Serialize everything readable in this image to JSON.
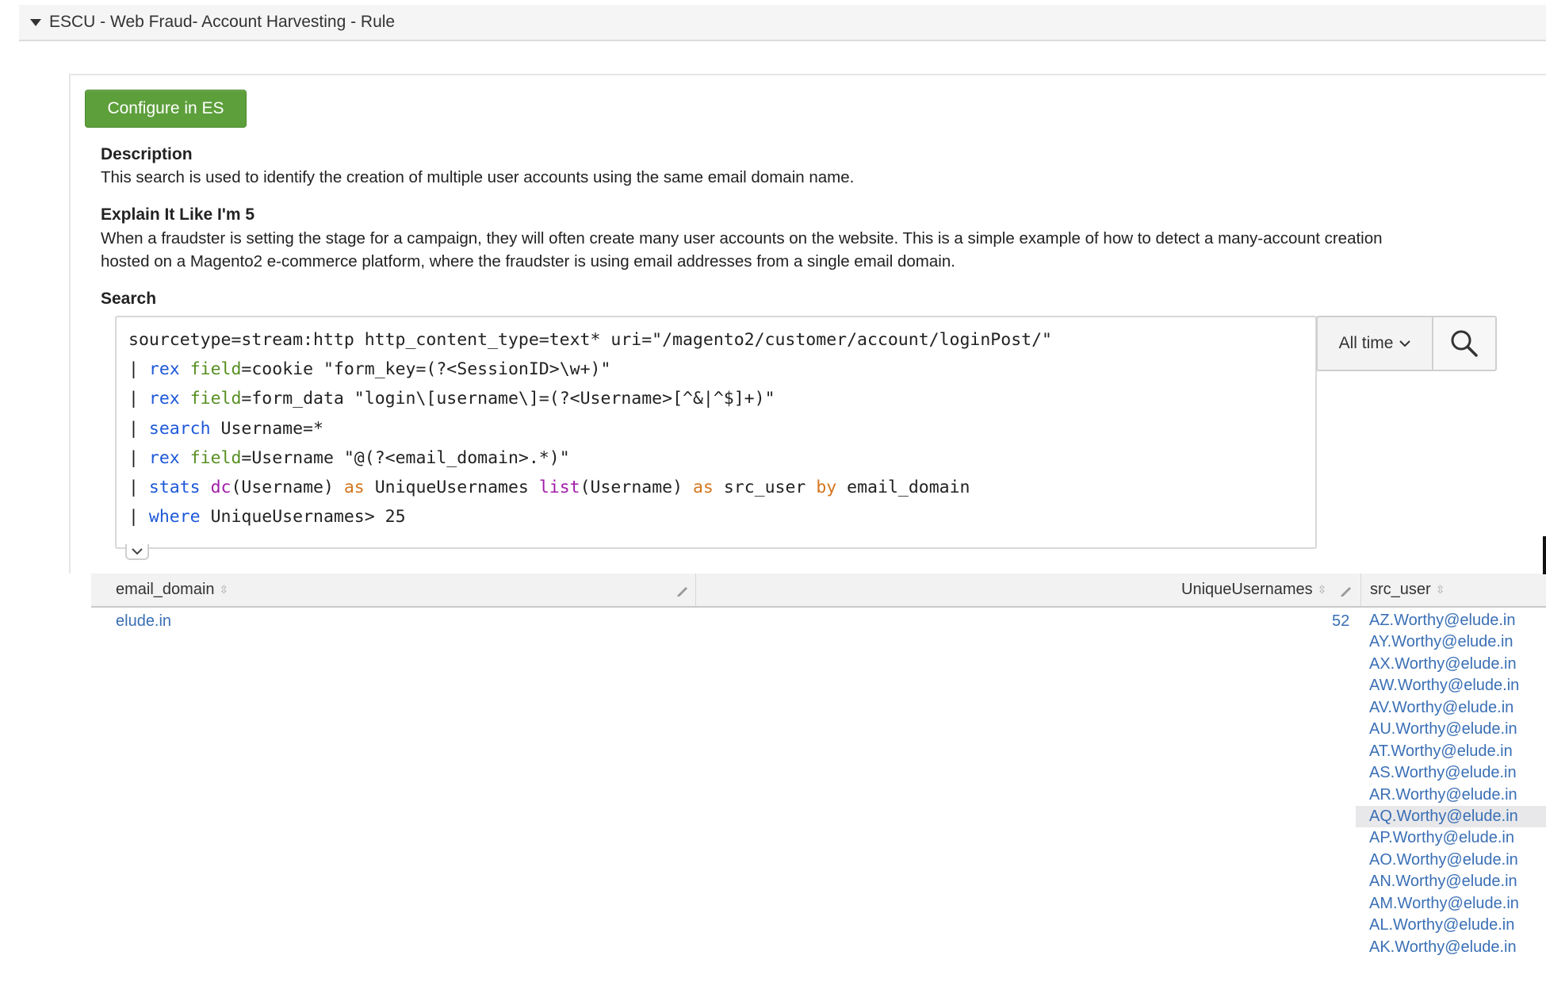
{
  "panel": {
    "title": "ESCU - Web Fraud- Account Harvesting - Rule",
    "configure_label": "Configure in ES"
  },
  "description": {
    "heading": "Description",
    "text": "This search is used to identify the creation of multiple user accounts using the same email domain name."
  },
  "eli5": {
    "heading": "Explain It Like I'm 5",
    "line1": "When a fraudster is setting the stage for a campaign, they will often create many user accounts on the website. This is a simple example of how to detect a many-account creation",
    "line2": "hosted on a Magento2 e-commerce platform, where the fraudster is using email addresses from a single email domain."
  },
  "search": {
    "heading": "Search",
    "time_range": "All time",
    "lines": [
      [
        {
          "t": "sourcetype=stream:http http_content_type=text* uri=\"/magento2/customer/account/loginPost/\""
        }
      ],
      [
        {
          "t": "| "
        },
        {
          "t": "rex",
          "c": "blue"
        },
        {
          "t": " "
        },
        {
          "t": "field",
          "c": "green"
        },
        {
          "t": "=cookie \"form_key=(?<SessionID>\\w+)\""
        }
      ],
      [
        {
          "t": "| "
        },
        {
          "t": "rex",
          "c": "blue"
        },
        {
          "t": " "
        },
        {
          "t": "field",
          "c": "green"
        },
        {
          "t": "=form_data \"login\\[username\\]=(?<Username>[^&|^$]+)\""
        }
      ],
      [
        {
          "t": "| "
        },
        {
          "t": "search",
          "c": "blue"
        },
        {
          "t": " Username=*"
        }
      ],
      [
        {
          "t": "| "
        },
        {
          "t": "rex",
          "c": "blue"
        },
        {
          "t": " "
        },
        {
          "t": "field",
          "c": "green"
        },
        {
          "t": "=Username \"@(?<email_domain>.*)\""
        }
      ],
      [
        {
          "t": "| "
        },
        {
          "t": "stats",
          "c": "blue"
        },
        {
          "t": " "
        },
        {
          "t": "dc",
          "c": "purple"
        },
        {
          "t": "(Username) "
        },
        {
          "t": "as",
          "c": "orange"
        },
        {
          "t": " UniqueUsernames "
        },
        {
          "t": "list",
          "c": "purple"
        },
        {
          "t": "(Username) "
        },
        {
          "t": "as",
          "c": "orange"
        },
        {
          "t": " src_user "
        },
        {
          "t": "by",
          "c": "orange"
        },
        {
          "t": " email_domain"
        }
      ],
      [
        {
          "t": "| "
        },
        {
          "t": "where",
          "c": "blue"
        },
        {
          "t": " UniqueUsernames> 25"
        }
      ]
    ]
  },
  "table": {
    "columns": [
      "email_domain",
      "UniqueUsernames",
      "src_user"
    ],
    "row": {
      "email_domain": "elude.in",
      "unique_usernames": "52",
      "src_user": [
        "AZ.Worthy@elude.in",
        "AY.Worthy@elude.in",
        "AX.Worthy@elude.in",
        "AW.Worthy@elude.in",
        "AV.Worthy@elude.in",
        "AU.Worthy@elude.in",
        "AT.Worthy@elude.in",
        "AS.Worthy@elude.in",
        "AR.Worthy@elude.in",
        "AQ.Worthy@elude.in",
        "AP.Worthy@elude.in",
        "AO.Worthy@elude.in",
        "AN.Worthy@elude.in",
        "AM.Worthy@elude.in",
        "AL.Worthy@elude.in",
        "AK.Worthy@elude.in"
      ],
      "highlighted_user": "AQ.Worthy@elude.in"
    }
  }
}
